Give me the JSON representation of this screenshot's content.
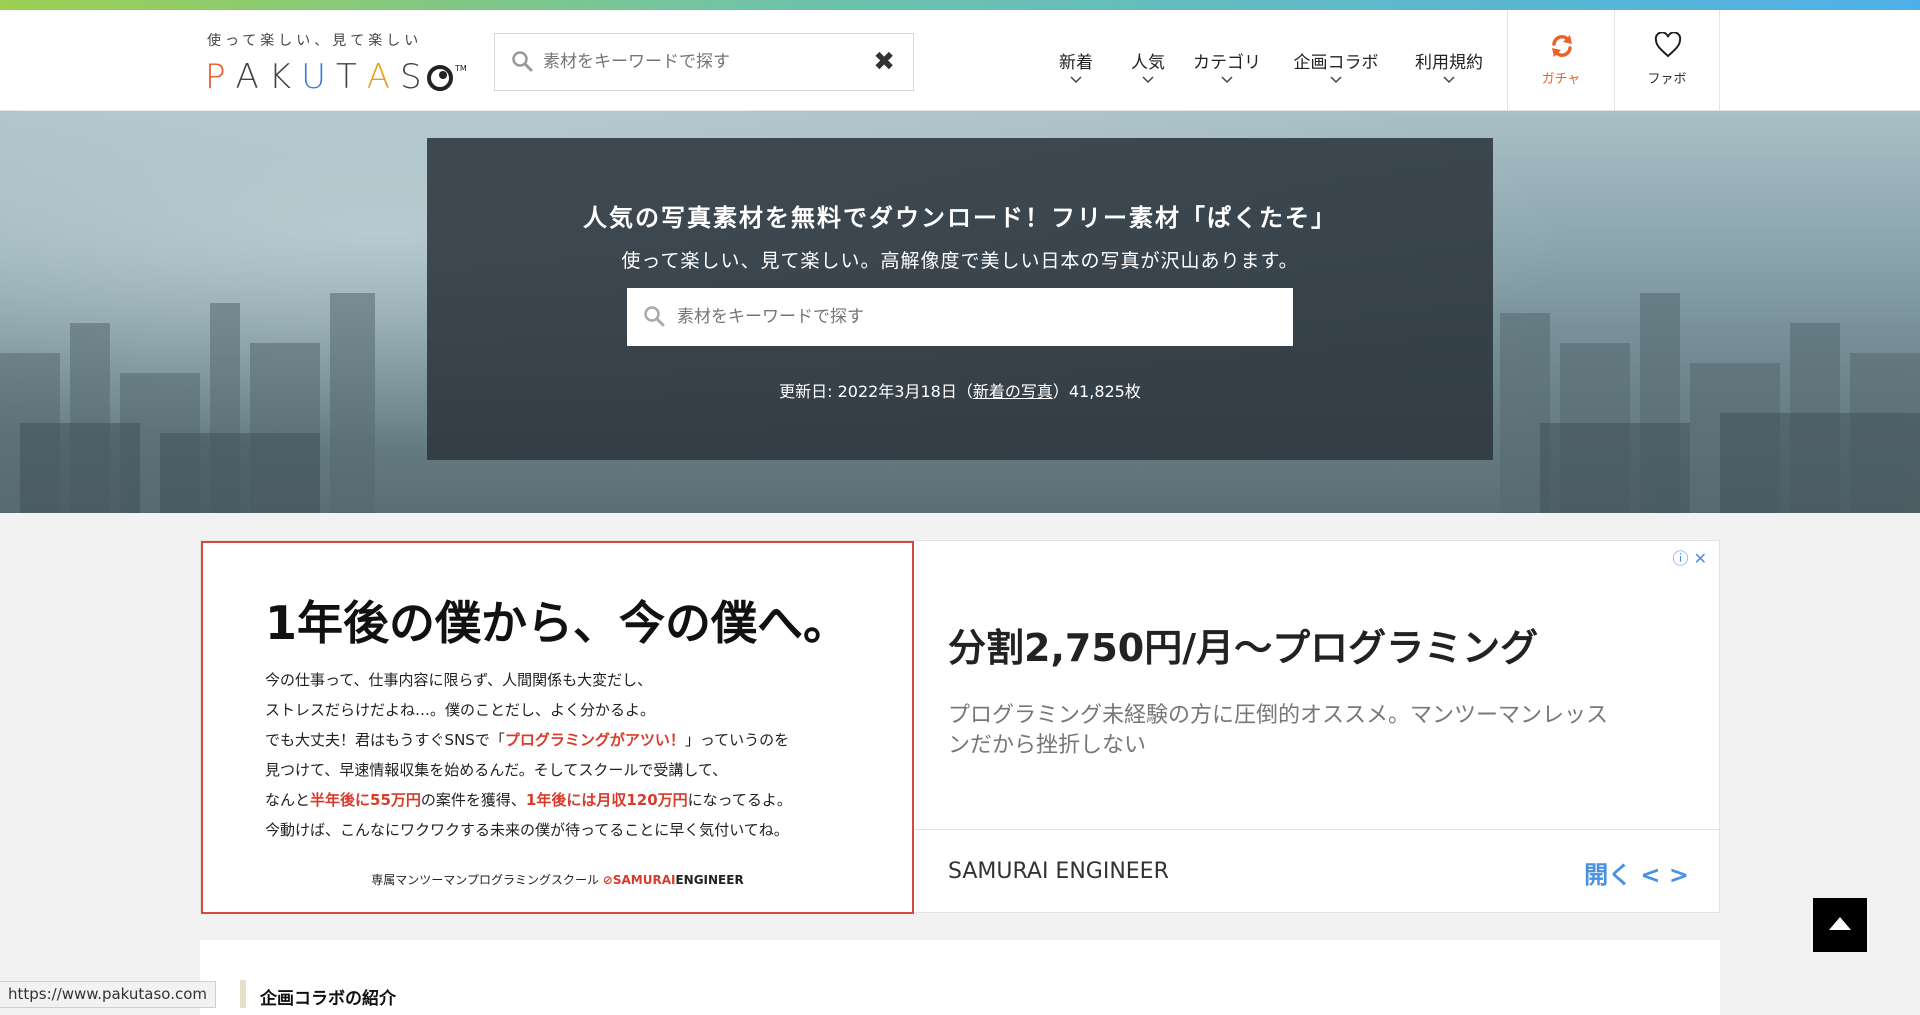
{
  "header": {
    "logo_tagline": "使って楽しい、見て楽しい",
    "logo_letters": [
      {
        "ch": "P",
        "color": "#e8572a"
      },
      {
        "ch": "A",
        "color": "#444444"
      },
      {
        "ch": "K",
        "color": "#444444"
      },
      {
        "ch": "U",
        "color": "#3a7bd5"
      },
      {
        "ch": "T",
        "color": "#444444"
      },
      {
        "ch": "A",
        "color": "#e8a21a"
      },
      {
        "ch": "S",
        "color": "#444444"
      }
    ],
    "logo_tm": "TM",
    "search_placeholder": "素材をキーワードで探す",
    "nav": [
      {
        "label": "新着"
      },
      {
        "label": "人気"
      },
      {
        "label": "カテゴリ"
      },
      {
        "label": "企画コラボ"
      },
      {
        "label": "利用規約"
      }
    ],
    "gacha_label": "ガチャ",
    "fav_label": "ファボ"
  },
  "hero": {
    "title": "人気の写真素材を無料でダウンロード！フリー素材「ぱくたそ」",
    "subtitle": "使って楽しい、見て楽しい。高解像度で美しい日本の写真が沢山あります。",
    "search_placeholder": "素材をキーワードで探す",
    "update_prefix": "更新日: 2022年3月18日（",
    "update_link": "新着の写真",
    "update_suffix": "）41,825枚"
  },
  "ad": {
    "headline": "1年後の僕から、今の僕へ。",
    "body_lines": [
      [
        {
          "t": "今の仕事って、仕事内容に限らず、人間関係も大変だし、",
          "red": false
        }
      ],
      [
        {
          "t": "ストレスだらけだよね…。僕のことだし、よく分かるよ。",
          "red": false
        }
      ],
      [
        {
          "t": "でも大丈夫！君はもうすぐSNSで「",
          "red": false
        },
        {
          "t": "プログラミングがアツい！",
          "red": true
        },
        {
          "t": "」っていうのを",
          "red": false
        }
      ],
      [
        {
          "t": "見つけて、早速情報収集を始めるんだ。そしてスクールで受講して、",
          "red": false
        }
      ],
      [
        {
          "t": "なんと",
          "red": false
        },
        {
          "t": "半年後に55万円",
          "red": true
        },
        {
          "t": "の案件を獲得、",
          "red": false
        },
        {
          "t": "1年後には月収120万円",
          "red": true
        },
        {
          "t": "になってるよ。",
          "red": false
        }
      ],
      [
        {
          "t": "今動けば、こんなにワクワクする未来の僕が待ってることに早く気付いてね。",
          "red": false
        }
      ]
    ],
    "footer_text": "専属マンツーマンプログラミングスクール",
    "footer_brand_a": "⊘SAMURAI",
    "footer_brand_b": "ENGINEER",
    "info_icons": "ⓘ ✕",
    "title": "分割2,750円/月〜プログラミング",
    "description": "プログラミング未経験の方に圧倒的オススメ。マンツーマンレッスンだから挫折しない",
    "sponsor": "SAMURAI ENGINEER",
    "open_label": "開く",
    "open_arrows": "<  >"
  },
  "collab": {
    "title": "企画コラボの紹介"
  },
  "status_url": "https://www.pakutaso.com"
}
